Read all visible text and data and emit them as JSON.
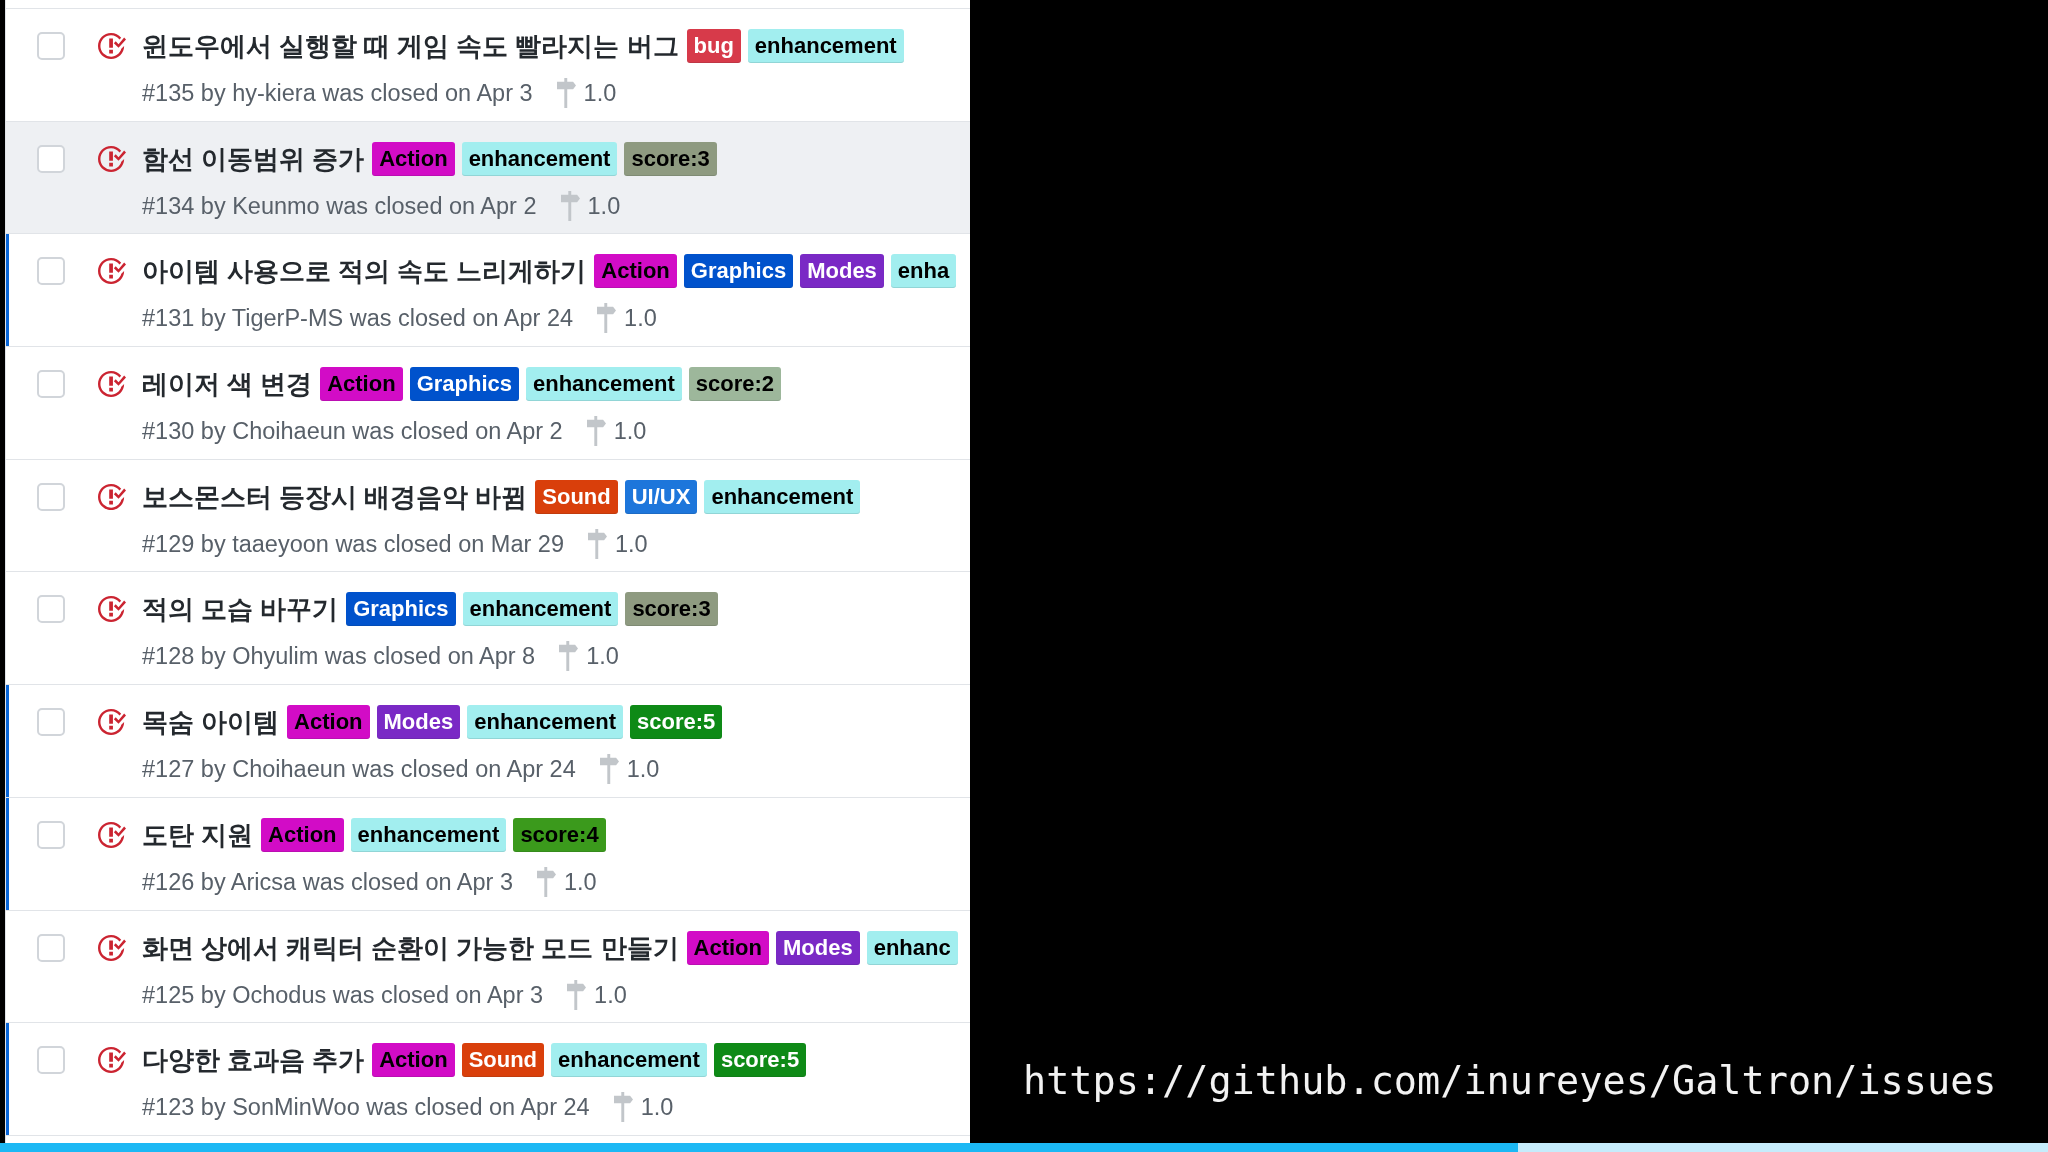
{
  "issues": [
    {
      "title": "윈도우에서 실행할 때 게임 속도 빨라지는 버그",
      "labels": [
        {
          "name": "bug",
          "color": "#d73a4a",
          "dark_text": false
        },
        {
          "name": "enhancement",
          "color": "#a2eeef",
          "dark_text": true
        }
      ],
      "meta": "#135 by hy-kiera was closed on Apr 3",
      "milestone": "1.0",
      "checked": false,
      "unread": false,
      "highlighted": false
    },
    {
      "title": "함선 이동범위 증가",
      "labels": [
        {
          "name": "Action",
          "color": "#d20cc6",
          "dark_text": true
        },
        {
          "name": "enhancement",
          "color": "#a2eeef",
          "dark_text": true
        },
        {
          "name": "score:3",
          "color": "#8e9a80",
          "dark_text": true
        }
      ],
      "meta": "#134 by Keunmo was closed on Apr 2",
      "milestone": "1.0",
      "checked": false,
      "unread": false,
      "highlighted": true
    },
    {
      "title": "아이템 사용으로 적의 속도 느리게하기",
      "labels": [
        {
          "name": "Action",
          "color": "#d20cc6",
          "dark_text": true
        },
        {
          "name": "Graphics",
          "color": "#0052cc",
          "dark_text": false
        },
        {
          "name": "Modes",
          "color": "#7a29c5",
          "dark_text": false
        },
        {
          "name": "enha",
          "color": "#a2eeef",
          "dark_text": true
        }
      ],
      "meta": "#131 by TigerP-MS was closed on Apr 24",
      "milestone": "1.0",
      "checked": false,
      "unread": true,
      "highlighted": false
    },
    {
      "title": "레이저 색 변경",
      "labels": [
        {
          "name": "Action",
          "color": "#d20cc6",
          "dark_text": true
        },
        {
          "name": "Graphics",
          "color": "#0052cc",
          "dark_text": false
        },
        {
          "name": "enhancement",
          "color": "#a2eeef",
          "dark_text": true
        },
        {
          "name": "score:2",
          "color": "#9db79b",
          "dark_text": true
        }
      ],
      "meta": "#130 by Choihaeun was closed on Apr 2",
      "milestone": "1.0",
      "checked": false,
      "unread": false,
      "highlighted": false
    },
    {
      "title": "보스몬스터 등장시 배경음악 바뀜",
      "labels": [
        {
          "name": "Sound",
          "color": "#d93f0b",
          "dark_text": false
        },
        {
          "name": "UI/UX",
          "color": "#1d76db",
          "dark_text": false
        },
        {
          "name": "enhancement",
          "color": "#a2eeef",
          "dark_text": true
        }
      ],
      "meta": "#129 by taaeyoon was closed on Mar 29",
      "milestone": "1.0",
      "checked": false,
      "unread": false,
      "highlighted": false
    },
    {
      "title": "적의 모습 바꾸기",
      "labels": [
        {
          "name": "Graphics",
          "color": "#0052cc",
          "dark_text": false
        },
        {
          "name": "enhancement",
          "color": "#a2eeef",
          "dark_text": true
        },
        {
          "name": "score:3",
          "color": "#8e9a80",
          "dark_text": true
        }
      ],
      "meta": "#128 by Ohyulim was closed on Apr 8",
      "milestone": "1.0",
      "checked": false,
      "unread": false,
      "highlighted": false
    },
    {
      "title": "목숨 아이템",
      "labels": [
        {
          "name": "Action",
          "color": "#d20cc6",
          "dark_text": true
        },
        {
          "name": "Modes",
          "color": "#7a29c5",
          "dark_text": false
        },
        {
          "name": "enhancement",
          "color": "#a2eeef",
          "dark_text": true
        },
        {
          "name": "score:5",
          "color": "#0e8a16",
          "dark_text": false
        }
      ],
      "meta": "#127 by Choihaeun was closed on Apr 24",
      "milestone": "1.0",
      "checked": false,
      "unread": true,
      "highlighted": false
    },
    {
      "title": "도탄 지원",
      "labels": [
        {
          "name": "Action",
          "color": "#d20cc6",
          "dark_text": true
        },
        {
          "name": "enhancement",
          "color": "#a2eeef",
          "dark_text": true
        },
        {
          "name": "score:4",
          "color": "#3b9a1c",
          "dark_text": true
        }
      ],
      "meta": "#126 by Aricsa was closed on Apr 3",
      "milestone": "1.0",
      "checked": false,
      "unread": true,
      "highlighted": false
    },
    {
      "title": "화면 상에서 캐릭터 순환이 가능한 모드 만들기",
      "labels": [
        {
          "name": "Action",
          "color": "#d20cc6",
          "dark_text": true
        },
        {
          "name": "Modes",
          "color": "#7a29c5",
          "dark_text": false
        },
        {
          "name": "enhanc",
          "color": "#a2eeef",
          "dark_text": true
        }
      ],
      "meta": "#125 by Ochodus was closed on Apr 3",
      "milestone": "1.0",
      "checked": false,
      "unread": false,
      "highlighted": false
    },
    {
      "title": "다양한 효과음 추가",
      "labels": [
        {
          "name": "Action",
          "color": "#d20cc6",
          "dark_text": true
        },
        {
          "name": "Sound",
          "color": "#d93f0b",
          "dark_text": false
        },
        {
          "name": "enhancement",
          "color": "#a2eeef",
          "dark_text": true
        },
        {
          "name": "score:5",
          "color": "#0e8a16",
          "dark_text": false
        }
      ],
      "meta": "#123 by SonMinWoo was closed on Apr 24",
      "milestone": "1.0",
      "checked": false,
      "unread": true,
      "highlighted": false
    }
  ],
  "caption": {
    "url": "https://github.com/inureyes/Galtron/issues"
  },
  "video_progress": {
    "level": 0.741
  }
}
